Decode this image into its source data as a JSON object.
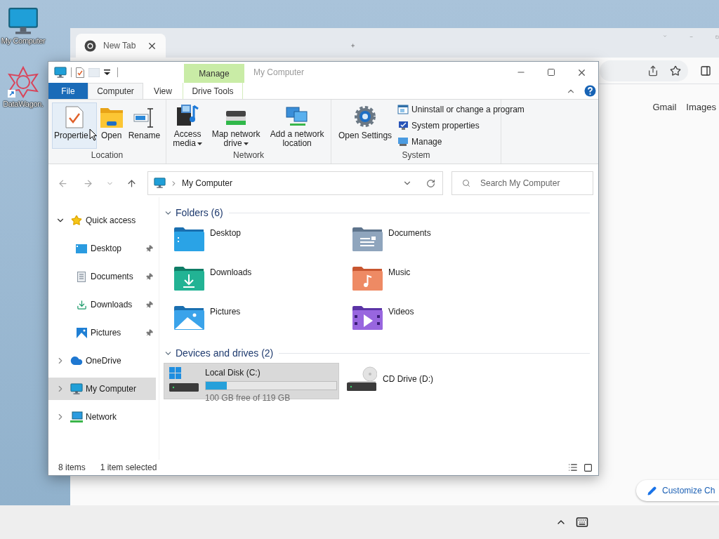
{
  "desktop_icons": [
    {
      "label": "My Computer",
      "kind": "computer"
    },
    {
      "label": "DataWagon.",
      "kind": "shortcut"
    }
  ],
  "browser": {
    "tabs": [
      {
        "title": "New Tab",
        "selected": true
      }
    ],
    "links": [
      "Gmail",
      "Images"
    ],
    "customize_button": "Customize Ch"
  },
  "explorer": {
    "title": "My Computer",
    "contextual_tab": "Manage",
    "ribbon_tabs": [
      {
        "label": "File",
        "kind": "file",
        "selected": false
      },
      {
        "label": "Computer",
        "kind": "tab",
        "selected": true
      },
      {
        "label": "View",
        "kind": "tab",
        "selected": false
      },
      {
        "label": "Drive Tools",
        "kind": "contextual",
        "selected": false
      }
    ],
    "ribbon_groups": [
      {
        "label": "Location",
        "buttons": [
          {
            "label": "Propertie",
            "kind": "properties",
            "hovered": true,
            "dropdown": false
          },
          {
            "label": "Open",
            "kind": "open",
            "hovered": false,
            "dropdown": false
          },
          {
            "label": "Rename",
            "kind": "rename",
            "hovered": false,
            "dropdown": false
          }
        ]
      },
      {
        "label": "Network",
        "buttons": [
          {
            "label": "Access media",
            "kind": "media",
            "hovered": false,
            "dropdown": true
          },
          {
            "label": "Map network drive",
            "kind": "drive",
            "hovered": false,
            "dropdown": true
          },
          {
            "label": "Add a network location",
            "kind": "network",
            "hovered": false,
            "dropdown": false
          }
        ]
      },
      {
        "label": "System",
        "buttons": [
          {
            "label": "Open Settings",
            "kind": "settings",
            "hovered": false,
            "dropdown": false
          }
        ],
        "small_buttons": [
          {
            "label": "Uninstall or change a program",
            "kind": "uninstall"
          },
          {
            "label": "System properties",
            "kind": "sysprops"
          },
          {
            "label": "Manage",
            "kind": "manage"
          }
        ]
      }
    ],
    "address": "My Computer",
    "search": {
      "placeholder": "Search My Computer"
    },
    "nav_tree": [
      {
        "label": "Quick access",
        "kind": "star",
        "expanded": true,
        "selected": false,
        "children": [
          {
            "label": "Desktop",
            "kind": "desktop",
            "pinned": true,
            "selected": false
          },
          {
            "label": "Documents",
            "kind": "documents",
            "pinned": true,
            "selected": false
          },
          {
            "label": "Downloads",
            "kind": "downloads",
            "pinned": true,
            "selected": false
          },
          {
            "label": "Pictures",
            "kind": "pictures",
            "pinned": true,
            "selected": false
          }
        ]
      },
      {
        "label": "OneDrive",
        "kind": "cloud",
        "expanded": false,
        "selected": false
      },
      {
        "label": "My Computer",
        "kind": "computer",
        "expanded": false,
        "selected": true
      },
      {
        "label": "Network",
        "kind": "network",
        "expanded": false,
        "selected": false
      }
    ],
    "sections": [
      {
        "title": "Folders (6)",
        "expanded": true,
        "items": [
          {
            "name": "Desktop",
            "kind": "desktop",
            "selected": false
          },
          {
            "name": "Documents",
            "kind": "documents",
            "selected": false
          },
          {
            "name": "Downloads",
            "kind": "downloads",
            "selected": false
          },
          {
            "name": "Music",
            "kind": "music",
            "selected": false
          },
          {
            "name": "Pictures",
            "kind": "pictures",
            "selected": false
          },
          {
            "name": "Videos",
            "kind": "videos",
            "selected": false
          }
        ]
      },
      {
        "title": "Devices and drives (2)",
        "expanded": true,
        "items": [
          {
            "name": "Local Disk (C:)",
            "kind": "disk",
            "level": 0.16,
            "free": "100 GB free of 119 GB",
            "selected": true
          },
          {
            "name": "CD Drive (D:)",
            "kind": "cd",
            "selected": false
          }
        ]
      }
    ],
    "status": {
      "items": "8 items",
      "selection": "1 item selected"
    }
  }
}
